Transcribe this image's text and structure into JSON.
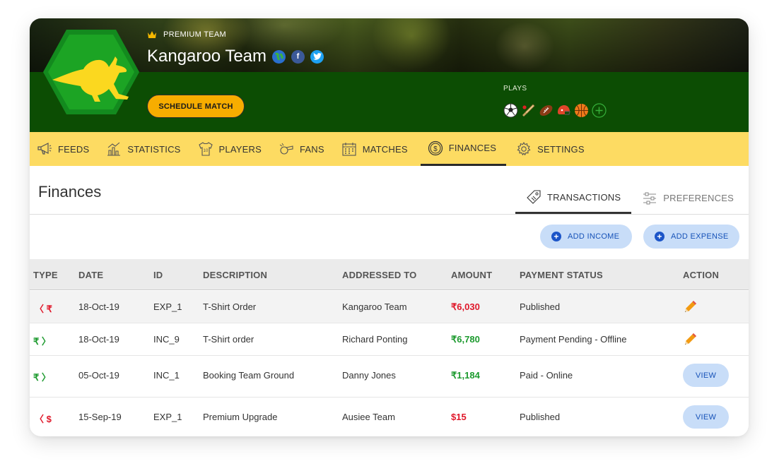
{
  "team": {
    "premium_label": "PREMIUM TEAM",
    "name": "Kangaroo Team",
    "schedule_label": "SCHEDULE MATCH",
    "plays_label": "PLAYS",
    "sports": [
      "football-icon",
      "cricket-icon",
      "rugby-icon",
      "helmet-icon",
      "basketball-icon",
      "add-sport-icon"
    ]
  },
  "tabs": [
    {
      "label": "FEEDS",
      "icon": "megaphone-icon"
    },
    {
      "label": "STATISTICS",
      "icon": "chart-icon"
    },
    {
      "label": "PLAYERS",
      "icon": "jersey-icon"
    },
    {
      "label": "FANS",
      "icon": "whistle-icon"
    },
    {
      "label": "MATCHES",
      "icon": "calendar-icon"
    },
    {
      "label": "FINANCES",
      "icon": "coin-icon",
      "active": true
    },
    {
      "label": "SETTINGS",
      "icon": "gear-icon"
    }
  ],
  "page": {
    "title": "Finances",
    "subtabs": [
      {
        "label": "TRANSACTIONS",
        "icon": "tag-icon",
        "active": true
      },
      {
        "label": "PREFERENCES",
        "icon": "sliders-icon"
      }
    ],
    "add_income": "ADD INCOME",
    "add_expense": "ADD EXPENSE"
  },
  "table": {
    "headers": [
      "TYPE",
      "DATE",
      "ID",
      "DESCRIPTION",
      "ADDRESSED TO",
      "AMOUNT",
      "PAYMENT STATUS",
      "ACTION"
    ],
    "rows": [
      {
        "type": "〈 ₹",
        "direction": "expense",
        "date": "18-Oct-19",
        "id": "EXP_1",
        "description": "T-Shirt Order",
        "addressed_to": "Kangaroo Team",
        "amount": "₹6,030",
        "status": "Published",
        "action": "edit"
      },
      {
        "type": "₹ 〉",
        "direction": "income",
        "date": "18-Oct-19",
        "id": "INC_9",
        "description": "T-Shirt order",
        "addressed_to": "Richard Ponting",
        "amount": "₹6,780",
        "status": "Payment Pending - Offline",
        "action": "edit"
      },
      {
        "type": "₹ 〉",
        "direction": "income",
        "date": "05-Oct-19",
        "id": "INC_1",
        "description": "Booking Team Ground",
        "addressed_to": "Danny Jones",
        "amount": "₹1,184",
        "status": "Paid - Online",
        "action": "VIEW"
      },
      {
        "type": "〈 $",
        "direction": "expense",
        "date": "15-Sep-19",
        "id": "EXP_1",
        "description": "Premium Upgrade",
        "addressed_to": "Ausiee Team",
        "amount": "$15",
        "status": "Published",
        "action": "VIEW"
      }
    ]
  },
  "colors": {
    "accent_yellow": "#fddb62",
    "team_green": "#0c4d03",
    "button_orange": "#f7ad00",
    "expense_red": "#e0182a",
    "income_green": "#1c9a2e",
    "button_blue": "#c8ddf8"
  }
}
